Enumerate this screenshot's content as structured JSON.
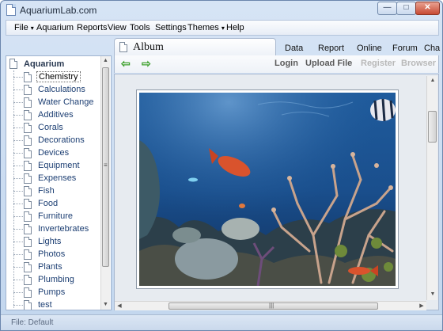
{
  "window": {
    "title": "AquariumLab.com",
    "controls": {
      "minimize_icon": "—",
      "maximize_icon": "□",
      "close_icon": "✕"
    }
  },
  "menubar": {
    "items": [
      {
        "label": "File",
        "caret": "▾"
      },
      {
        "label": "Aquarium"
      },
      {
        "label": "Reports"
      },
      {
        "label": "View"
      },
      {
        "label": "Tools"
      },
      {
        "label": "Settings"
      },
      {
        "label": "Themes",
        "caret": "▾"
      },
      {
        "label": "Help"
      }
    ]
  },
  "tree": {
    "root": "Aquarium",
    "items": [
      "Chemistry",
      "Calculations",
      "Water Change",
      "Additives",
      "Corals",
      "Decorations",
      "Devices",
      "Equipment",
      "Expenses",
      "Fish",
      "Food",
      "Furniture",
      "Invertebrates",
      "Lights",
      "Photos",
      "Plants",
      "Plumbing",
      "Pumps",
      "test"
    ],
    "selected": "Chemistry"
  },
  "tabs": {
    "active": "Album",
    "others": [
      "Data",
      "Report",
      "Online",
      "Forum",
      "Cha"
    ]
  },
  "toolbar": {
    "back_icon": "⇦",
    "forward_icon": "⇨",
    "links": [
      {
        "label": "Login",
        "state": "enabled"
      },
      {
        "label": "Upload File",
        "state": "enabled"
      },
      {
        "label": "Register",
        "state": "disabled"
      },
      {
        "label": "Browser",
        "state": "disabled"
      }
    ]
  },
  "content": {
    "image": "aquarium-reef-photo"
  },
  "scroll": {
    "up": "▲",
    "down": "▼",
    "left": "◀",
    "right": "▶",
    "grip_v": "≡",
    "grip_h": "|||"
  },
  "statusbar": {
    "text": "File: Default"
  },
  "colors": {
    "link_blue": "#1d3f73",
    "arrow_green": "#3ea12e",
    "disabled_gray": "#b8b8b8",
    "window_frame": "#c2d6ee"
  }
}
